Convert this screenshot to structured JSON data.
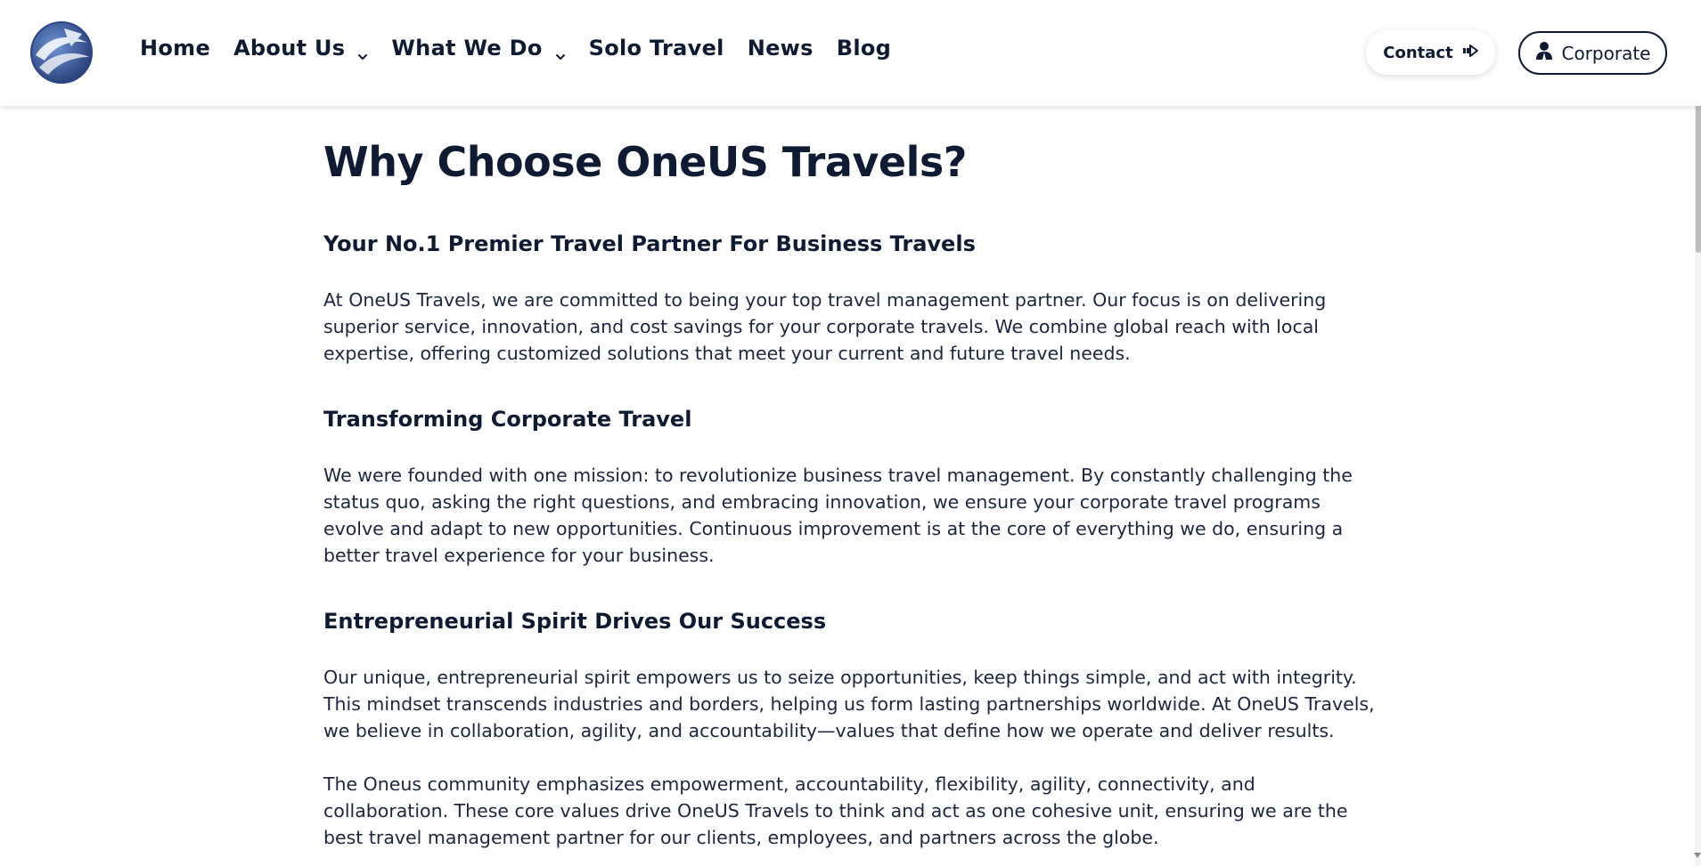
{
  "header": {
    "logo_icon": "oneus-globe-logo-icon",
    "nav": [
      {
        "label": "Home",
        "has_dropdown": false
      },
      {
        "label": "About Us",
        "has_dropdown": true
      },
      {
        "label": "What We Do",
        "has_dropdown": true
      },
      {
        "label": "Solo Travel",
        "has_dropdown": false
      },
      {
        "label": "News",
        "has_dropdown": false
      },
      {
        "label": "Blog",
        "has_dropdown": false
      }
    ],
    "contact_label": "Contact",
    "contact_icon": "arrow-right-icon",
    "corporate_label": "Corporate",
    "corporate_icon": "user-icon"
  },
  "main": {
    "title": "Why Choose OneUS Travels?",
    "sections": [
      {
        "heading": "Your No.1 Premier Travel Partner For Business Travels",
        "paragraphs": [
          "At OneUS Travels, we are committed to being your top travel management partner. Our focus is on delivering superior service, innovation, and cost savings for your corporate travels. We combine global reach with local expertise, offering customized solutions that meet your current and future travel needs."
        ]
      },
      {
        "heading": "Transforming Corporate Travel",
        "paragraphs": [
          "We were founded with one mission: to revolutionize business travel management. By constantly challenging the status quo, asking the right questions, and embracing innovation, we ensure your corporate travel programs evolve and adapt to new opportunities. Continuous improvement is at the core of everything we do, ensuring a better travel experience for your business."
        ]
      },
      {
        "heading": "Entrepreneurial Spirit Drives Our Success",
        "paragraphs": [
          "Our unique, entrepreneurial spirit empowers us to seize opportunities, keep things simple, and act with integrity. This mindset transcends industries and borders, helping us form lasting partnerships worldwide. At OneUS Travels, we believe in collaboration, agility, and accountability—values that define how we operate and deliver results.",
          "The Oneus community emphasizes empowerment, accountability, flexibility, agility, connectivity, and collaboration. These core values drive OneUS Travels to think and act as one cohesive unit, ensuring we are the best travel management partner for our clients, employees, and partners across the globe."
        ]
      }
    ]
  },
  "colors": {
    "primary_text": "#0f1b33",
    "body_text": "#1c2640",
    "logo_blue": "#3a5ea8"
  }
}
